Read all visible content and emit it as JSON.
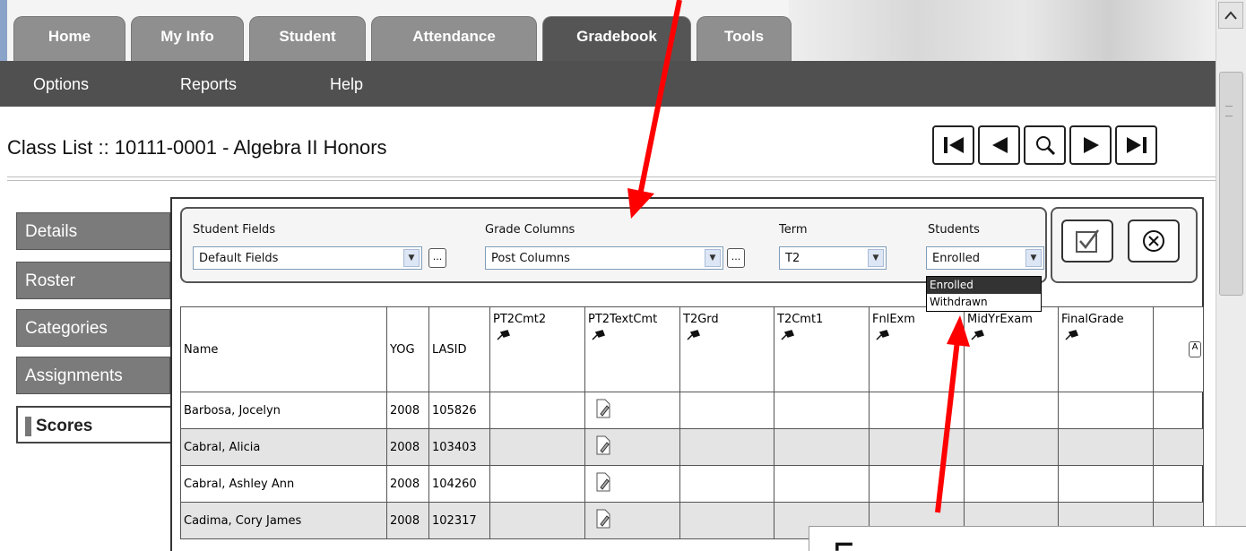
{
  "top_tabs": [
    "Home",
    "My Info",
    "Student",
    "Attendance",
    "Gradebook",
    "Tools"
  ],
  "submenu": [
    "Options",
    "Reports",
    "Help"
  ],
  "page_title": "Class List :: 10111-0001 - Algebra II Honors",
  "side_tabs": [
    "Details",
    "Roster",
    "Categories",
    "Assignments",
    "Scores"
  ],
  "filters": {
    "student_fields_label": "Student Fields",
    "student_fields_value": "Default Fields",
    "grade_columns_label": "Grade Columns",
    "grade_columns_value": "Post Columns",
    "term_label": "Term",
    "term_value": "T2",
    "students_label": "Students",
    "students_value": "Enrolled",
    "students_options": [
      "Enrolled",
      "Withdrawn"
    ],
    "ellipsis": "..."
  },
  "grid": {
    "headers": [
      "Name",
      "YOG",
      "LASID",
      "PT2Cmt2",
      "PT2TextCmt",
      "T2Grd",
      "T2Cmt1",
      "FnlExm",
      "MidYrExam",
      "FinalGrade"
    ],
    "rows": [
      {
        "name": "Barbosa, Jocelyn",
        "yog": "2008",
        "lasid": "105826"
      },
      {
        "name": "Cabral, Alicia",
        "yog": "2008",
        "lasid": "103403"
      },
      {
        "name": "Cabral, Ashley Ann",
        "yog": "2008",
        "lasid": "104260"
      },
      {
        "name": "Cadima, Cory James",
        "yog": "2008",
        "lasid": "102317"
      }
    ]
  },
  "colors": {
    "tab": "#8f8f8f",
    "tab_active": "#555555",
    "submenu": "#505050",
    "annotation_arrow": "#ff0000",
    "row_alt": "#e4e4e4"
  },
  "icons": {
    "pin": "pin-icon",
    "edit": "edit-comment-icon",
    "check": "checkbox-check-icon",
    "cancel": "cancel-circle-x-icon"
  }
}
